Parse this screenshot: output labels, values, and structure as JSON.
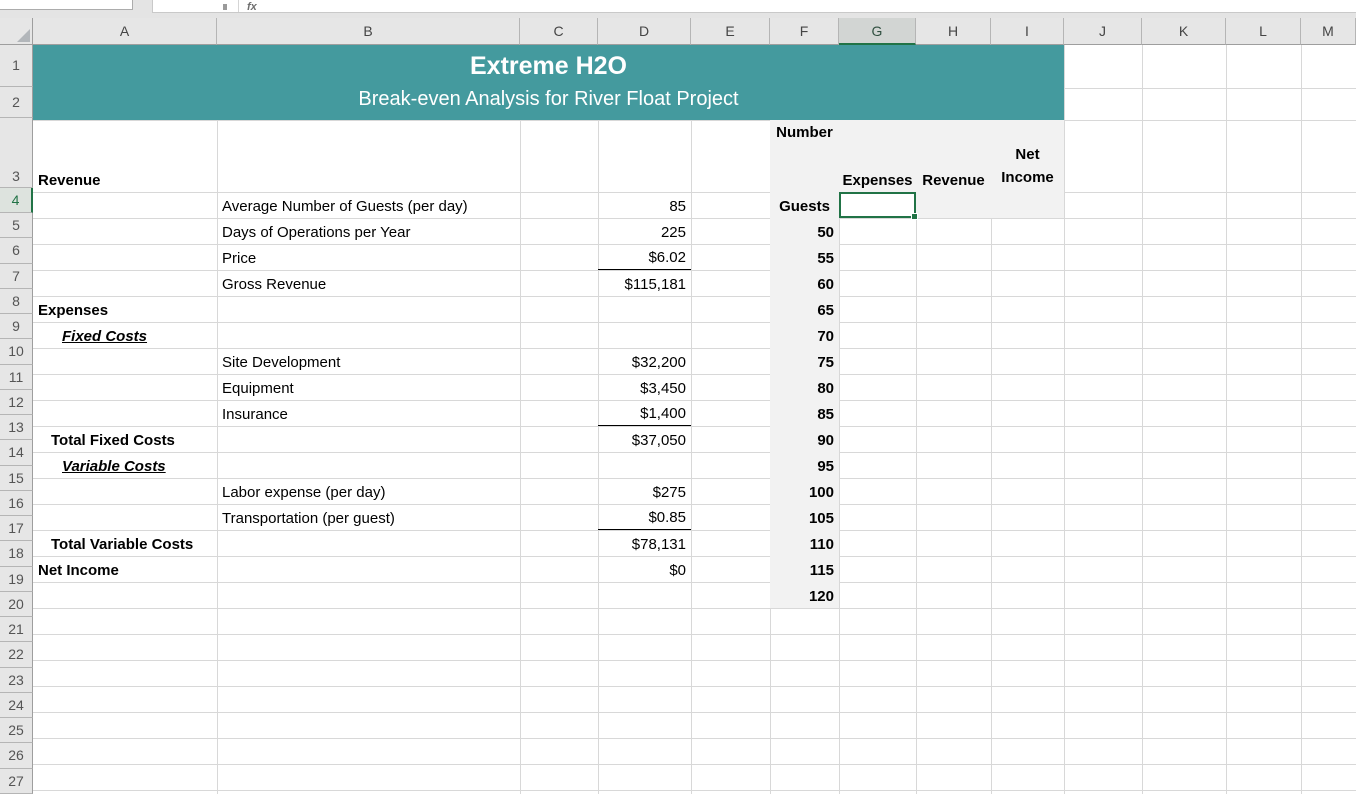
{
  "chrome": {
    "name_box_value": "",
    "formula_bar_value": ""
  },
  "sheet": {
    "selected_cell": "G4",
    "columns": [
      "A",
      "B",
      "C",
      "D",
      "E",
      "F",
      "G",
      "H",
      "I",
      "J",
      "K",
      "L",
      "M"
    ],
    "rows": [
      "1",
      "2",
      "3",
      "4",
      "5",
      "6",
      "7",
      "8",
      "9",
      "10",
      "11",
      "12",
      "13",
      "14",
      "15",
      "16",
      "17",
      "18",
      "19",
      "20",
      "21",
      "22",
      "23",
      "24",
      "25",
      "26",
      "27"
    ]
  },
  "banner": {
    "title": "Extreme H2O",
    "subtitle": "Break-even Analysis for River Float Project"
  },
  "cells": {
    "a3": "Revenue",
    "b4": "Average Number of Guests (per day)",
    "d4": "85",
    "b5": "Days of Operations per Year",
    "d5": "225",
    "b6": "Price",
    "d6": "$6.02",
    "b7": "Gross Revenue",
    "d7": "$115,181",
    "a8": "Expenses",
    "a9": "Fixed Costs",
    "b10": "Site Development",
    "d10": "$32,200",
    "b11": "Equipment",
    "d11": "$3,450",
    "b12": "Insurance",
    "d12": "$1,400",
    "a13": "Total Fixed Costs",
    "d13": "$37,050",
    "a14": "Variable Costs",
    "b15": "Labor expense (per day)",
    "d15": "$275",
    "b16": "Transportation (per guest)",
    "d16": "$0.85",
    "a17": "Total Variable Costs",
    "d17": "$78,131",
    "a18": "Net Income",
    "d18": "$0"
  },
  "breakeven": {
    "number_header": "Number",
    "guests_label": "Guests",
    "expenses_header": "Expenses",
    "revenue_header": "Revenue",
    "net_income_header": "Net Income",
    "guest_numbers": [
      "50",
      "55",
      "60",
      "65",
      "70",
      "75",
      "80",
      "85",
      "90",
      "95",
      "100",
      "105",
      "110",
      "115",
      "120"
    ]
  },
  "colors": {
    "banner_teal": "#449A9E",
    "selection_green": "#217346",
    "fill_gray": "#F2F2F2"
  }
}
